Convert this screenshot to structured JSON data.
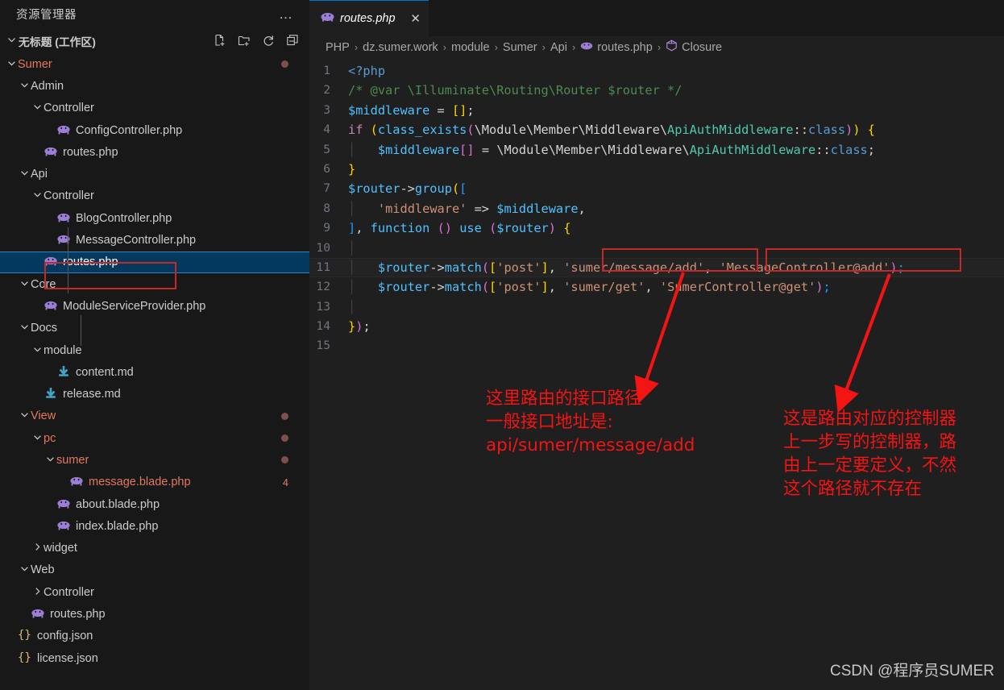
{
  "sidebar": {
    "header_title": "资源管理器",
    "more_actions": "…",
    "workspace": {
      "label": "无标题 (工作区)",
      "chevron": "⌄",
      "actions": [
        {
          "name": "new-file-icon",
          "label": "新建文件"
        },
        {
          "name": "new-folder-icon",
          "label": "新建文件夹"
        },
        {
          "name": "refresh-icon",
          "label": "刷新"
        },
        {
          "name": "collapse-all-icon",
          "label": "折叠"
        }
      ]
    },
    "tree": [
      {
        "label": "Sumer",
        "kind": "folder",
        "depth": 1,
        "expanded": true,
        "modified": true,
        "badge": "●"
      },
      {
        "label": "Admin",
        "kind": "folder",
        "depth": 2,
        "expanded": true
      },
      {
        "label": "Controller",
        "kind": "folder",
        "depth": 3,
        "expanded": true
      },
      {
        "label": "ConfigController.php",
        "kind": "php",
        "depth": 4
      },
      {
        "label": "routes.php",
        "kind": "php",
        "depth": 3
      },
      {
        "label": "Api",
        "kind": "folder",
        "depth": 2,
        "expanded": true
      },
      {
        "label": "Controller",
        "kind": "folder",
        "depth": 3,
        "expanded": true
      },
      {
        "label": "BlogController.php",
        "kind": "php",
        "depth": 4
      },
      {
        "label": "MessageController.php",
        "kind": "php",
        "depth": 4
      },
      {
        "label": "routes.php",
        "kind": "php",
        "depth": 3,
        "selected": true
      },
      {
        "label": "Core",
        "kind": "folder",
        "depth": 2,
        "expanded": true
      },
      {
        "label": "ModuleServiceProvider.php",
        "kind": "php",
        "depth": 3
      },
      {
        "label": "Docs",
        "kind": "folder",
        "depth": 2,
        "expanded": true
      },
      {
        "label": "module",
        "kind": "folder",
        "depth": 3,
        "expanded": true
      },
      {
        "label": "content.md",
        "kind": "md",
        "depth": 4
      },
      {
        "label": "release.md",
        "kind": "md",
        "depth": 3
      },
      {
        "label": "View",
        "kind": "folder",
        "depth": 2,
        "expanded": true,
        "modified": true,
        "badge": "●"
      },
      {
        "label": "pc",
        "kind": "folder",
        "depth": 3,
        "expanded": true,
        "modified": true,
        "badge": "●"
      },
      {
        "label": "sumer",
        "kind": "folder",
        "depth": 4,
        "expanded": true,
        "modified": true,
        "badge": "●"
      },
      {
        "label": "message.blade.php",
        "kind": "php",
        "depth": 5,
        "modified": true,
        "badge": "4"
      },
      {
        "label": "about.blade.php",
        "kind": "php",
        "depth": 4
      },
      {
        "label": "index.blade.php",
        "kind": "php",
        "depth": 4
      },
      {
        "label": "widget",
        "kind": "folder",
        "depth": 3,
        "expanded": false
      },
      {
        "label": "Web",
        "kind": "folder",
        "depth": 2,
        "expanded": true
      },
      {
        "label": "Controller",
        "kind": "folder",
        "depth": 3,
        "expanded": false
      },
      {
        "label": "routes.php",
        "kind": "php",
        "depth": 2
      },
      {
        "label": "config.json",
        "kind": "json",
        "depth": 1
      },
      {
        "label": "license.json",
        "kind": "json",
        "depth": 1
      }
    ]
  },
  "editor": {
    "tab": {
      "label": "routes.php",
      "icon": "php-icon",
      "close": "✕"
    },
    "breadcrumb": [
      {
        "label": "PHP",
        "icon": null
      },
      {
        "label": "dz.sumer.work",
        "icon": null
      },
      {
        "label": "module",
        "icon": null
      },
      {
        "label": "Sumer",
        "icon": null
      },
      {
        "label": "Api",
        "icon": null
      },
      {
        "label": "routes.php",
        "icon": "php-icon"
      },
      {
        "label": "Closure",
        "icon": "symbol-closure-icon"
      }
    ],
    "breadcrumb_separator": "›",
    "line_numbers": [
      "1",
      "2",
      "3",
      "4",
      "5",
      "6",
      "7",
      "8",
      "9",
      "10",
      "11",
      "12",
      "13",
      "14",
      "15"
    ],
    "current_line": 11,
    "code_lines": [
      "<?php",
      "/* @var \\Illuminate\\Routing\\Router $router */",
      "$middleware = [];",
      "if (class_exists(\\Module\\Member\\Middleware\\ApiAuthMiddleware::class)) {",
      "    $middleware[] = \\Module\\Member\\Middleware\\ApiAuthMiddleware::class;",
      "}",
      "$router->group([",
      "    'middleware' => $middleware,",
      "], function () use ($router) {",
      "",
      "    $router->match(['post'], 'sumer/message/add', 'MessageController@add');",
      "    $router->match(['post'], 'sumer/get', 'SumerController@get');",
      "",
      "});",
      ""
    ]
  },
  "annotations": {
    "color": "#f41414",
    "left": {
      "lines": [
        "这里路由的接口路径",
        "一般接口地址是:",
        "api/sumer/message/add"
      ]
    },
    "right": {
      "lines": [
        "这是路由对应的控制器",
        "上一步写的控制器，路",
        "由上一定要定义，不然",
        "这个路径就不存在"
      ]
    },
    "highlight_boxes": [
      {
        "name": "route-path-highlight",
        "target": "'sumer/message/add',"
      },
      {
        "name": "controller-highlight",
        "target": "'MessageController@add');"
      },
      {
        "name": "sidebar-routes-highlight",
        "target": "routes.php"
      }
    ]
  },
  "watermark": "CSDN @程序员SUMER"
}
